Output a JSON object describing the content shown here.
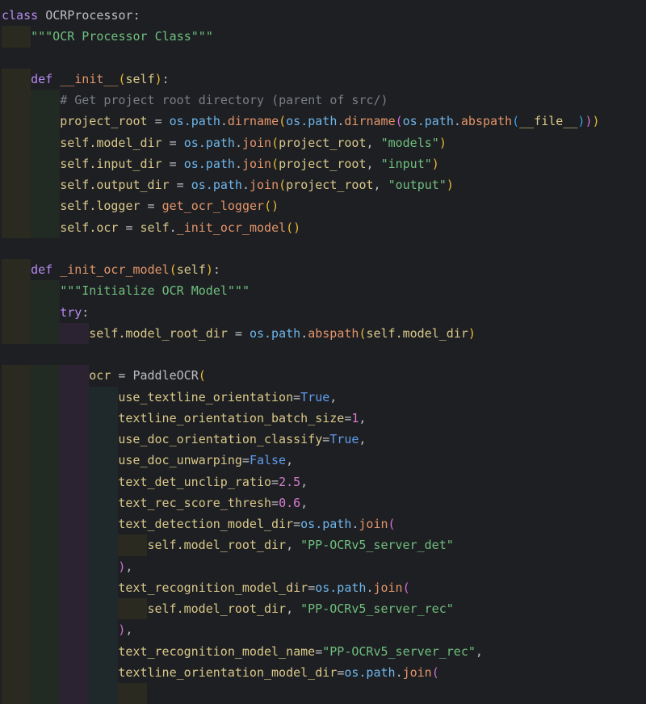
{
  "editor": {
    "lines": [
      {
        "indent": 0,
        "tokens": [
          [
            "class ",
            "k"
          ],
          [
            "OCRProcessor",
            "p"
          ],
          [
            ":",
            "p"
          ]
        ]
      },
      {
        "indent": 1,
        "tokens": [
          [
            "\"\"\"OCR Processor Class\"\"\"",
            "s"
          ]
        ]
      },
      {
        "indent": 0,
        "tokens": []
      },
      {
        "indent": 1,
        "tokens": [
          [
            "def ",
            "k"
          ],
          [
            "__init__",
            "f"
          ],
          [
            "(",
            "y"
          ],
          [
            "self",
            "v"
          ],
          [
            ")",
            "y"
          ],
          [
            ":",
            "p"
          ]
        ]
      },
      {
        "indent": 2,
        "tokens": [
          [
            "# Get project root directory (parent of src/)",
            "c"
          ]
        ]
      },
      {
        "indent": 2,
        "tokens": [
          [
            "project_root",
            "v"
          ],
          [
            " = ",
            "p"
          ],
          [
            "os.path",
            "o"
          ],
          [
            ".",
            "p"
          ],
          [
            "dirname",
            "f"
          ],
          [
            "(",
            "y"
          ],
          [
            "os.path",
            "o"
          ],
          [
            ".",
            "p"
          ],
          [
            "dirname",
            "f"
          ],
          [
            "(",
            "m"
          ],
          [
            "os.path",
            "o"
          ],
          [
            ".",
            "p"
          ],
          [
            "abspath",
            "f"
          ],
          [
            "(",
            "l"
          ],
          [
            "__file__",
            "v"
          ],
          [
            ")",
            "l"
          ],
          [
            ")",
            "m"
          ],
          [
            ")",
            "y"
          ]
        ]
      },
      {
        "indent": 2,
        "tokens": [
          [
            "self",
            "v"
          ],
          [
            ".model_dir",
            "v"
          ],
          [
            " = ",
            "p"
          ],
          [
            "os.path",
            "o"
          ],
          [
            ".",
            "p"
          ],
          [
            "join",
            "f"
          ],
          [
            "(",
            "y"
          ],
          [
            "project_root",
            "v"
          ],
          [
            ", ",
            "p"
          ],
          [
            "\"models\"",
            "s"
          ],
          [
            ")",
            "y"
          ]
        ]
      },
      {
        "indent": 2,
        "tokens": [
          [
            "self",
            "v"
          ],
          [
            ".input_dir",
            "v"
          ],
          [
            " = ",
            "p"
          ],
          [
            "os.path",
            "o"
          ],
          [
            ".",
            "p"
          ],
          [
            "join",
            "f"
          ],
          [
            "(",
            "y"
          ],
          [
            "project_root",
            "v"
          ],
          [
            ", ",
            "p"
          ],
          [
            "\"input\"",
            "s"
          ],
          [
            ")",
            "y"
          ]
        ]
      },
      {
        "indent": 2,
        "tokens": [
          [
            "self",
            "v"
          ],
          [
            ".output_dir",
            "v"
          ],
          [
            " = ",
            "p"
          ],
          [
            "os.path",
            "o"
          ],
          [
            ".",
            "p"
          ],
          [
            "join",
            "f"
          ],
          [
            "(",
            "y"
          ],
          [
            "project_root",
            "v"
          ],
          [
            ", ",
            "p"
          ],
          [
            "\"output\"",
            "s"
          ],
          [
            ")",
            "y"
          ]
        ]
      },
      {
        "indent": 2,
        "tokens": [
          [
            "self",
            "v"
          ],
          [
            ".logger",
            "v"
          ],
          [
            " = ",
            "p"
          ],
          [
            "get_ocr_logger",
            "f"
          ],
          [
            "()",
            "y"
          ]
        ]
      },
      {
        "indent": 2,
        "tokens": [
          [
            "self",
            "v"
          ],
          [
            ".ocr",
            "v"
          ],
          [
            " = ",
            "p"
          ],
          [
            "self",
            "v"
          ],
          [
            ".",
            "p"
          ],
          [
            "_init_ocr_model",
            "f"
          ],
          [
            "()",
            "y"
          ]
        ]
      },
      {
        "indent": 0,
        "tokens": []
      },
      {
        "indent": 1,
        "tokens": [
          [
            "def ",
            "k"
          ],
          [
            "_init_ocr_model",
            "f"
          ],
          [
            "(",
            "y"
          ],
          [
            "self",
            "v"
          ],
          [
            ")",
            "y"
          ],
          [
            ":",
            "p"
          ]
        ]
      },
      {
        "indent": 2,
        "tokens": [
          [
            "\"\"\"Initialize OCR Model\"\"\"",
            "s"
          ]
        ]
      },
      {
        "indent": 2,
        "tokens": [
          [
            "try",
            "k"
          ],
          [
            ":",
            "p"
          ]
        ]
      },
      {
        "indent": 3,
        "tokens": [
          [
            "self",
            "v"
          ],
          [
            ".model_root_dir",
            "v"
          ],
          [
            " = ",
            "p"
          ],
          [
            "os.path",
            "o"
          ],
          [
            ".",
            "p"
          ],
          [
            "abspath",
            "f"
          ],
          [
            "(",
            "y"
          ],
          [
            "self",
            "v"
          ],
          [
            ".model_dir",
            "v"
          ],
          [
            ")",
            "y"
          ]
        ]
      },
      {
        "indent": 0,
        "tokens": []
      },
      {
        "indent": 3,
        "tokens": [
          [
            "ocr",
            "v"
          ],
          [
            " = ",
            "p"
          ],
          [
            "PaddleOCR",
            "p"
          ],
          [
            "(",
            "y"
          ]
        ]
      },
      {
        "indent": 4,
        "tokens": [
          [
            "use_textline_orientation",
            "v"
          ],
          [
            "=",
            "p"
          ],
          [
            "True",
            "b"
          ],
          [
            ",",
            "p"
          ]
        ]
      },
      {
        "indent": 4,
        "tokens": [
          [
            "textline_orientation_batch_size",
            "v"
          ],
          [
            "=",
            "p"
          ],
          [
            "1",
            "n"
          ],
          [
            ",",
            "p"
          ]
        ]
      },
      {
        "indent": 4,
        "tokens": [
          [
            "use_doc_orientation_classify",
            "v"
          ],
          [
            "=",
            "p"
          ],
          [
            "True",
            "b"
          ],
          [
            ",",
            "p"
          ]
        ]
      },
      {
        "indent": 4,
        "tokens": [
          [
            "use_doc_unwarping",
            "v"
          ],
          [
            "=",
            "p"
          ],
          [
            "False",
            "b"
          ],
          [
            ",",
            "p"
          ]
        ]
      },
      {
        "indent": 4,
        "tokens": [
          [
            "text_det_unclip_ratio",
            "v"
          ],
          [
            "=",
            "p"
          ],
          [
            "2.5",
            "n"
          ],
          [
            ",",
            "p"
          ]
        ]
      },
      {
        "indent": 4,
        "tokens": [
          [
            "text_rec_score_thresh",
            "v"
          ],
          [
            "=",
            "p"
          ],
          [
            "0.6",
            "n"
          ],
          [
            ",",
            "p"
          ]
        ]
      },
      {
        "indent": 4,
        "tokens": [
          [
            "text_detection_model_dir",
            "v"
          ],
          [
            "=",
            "p"
          ],
          [
            "os.path",
            "o"
          ],
          [
            ".",
            "p"
          ],
          [
            "join",
            "f"
          ],
          [
            "(",
            "m"
          ]
        ]
      },
      {
        "indent": 5,
        "tokens": [
          [
            "self",
            "v"
          ],
          [
            ".model_root_dir",
            "v"
          ],
          [
            ", ",
            "p"
          ],
          [
            "\"PP-OCRv5_server_det\"",
            "s"
          ]
        ]
      },
      {
        "indent": 4,
        "tokens": [
          [
            ")",
            "m"
          ],
          [
            ",",
            "p"
          ]
        ]
      },
      {
        "indent": 4,
        "tokens": [
          [
            "text_recognition_model_dir",
            "v"
          ],
          [
            "=",
            "p"
          ],
          [
            "os.path",
            "o"
          ],
          [
            ".",
            "p"
          ],
          [
            "join",
            "f"
          ],
          [
            "(",
            "m"
          ]
        ]
      },
      {
        "indent": 5,
        "tokens": [
          [
            "self",
            "v"
          ],
          [
            ".model_root_dir",
            "v"
          ],
          [
            ", ",
            "p"
          ],
          [
            "\"PP-OCRv5_server_rec\"",
            "s"
          ]
        ]
      },
      {
        "indent": 4,
        "tokens": [
          [
            ")",
            "m"
          ],
          [
            ",",
            "p"
          ]
        ]
      },
      {
        "indent": 4,
        "tokens": [
          [
            "text_recognition_model_name",
            "v"
          ],
          [
            "=",
            "p"
          ],
          [
            "\"PP-OCRv5_server_rec\"",
            "s"
          ],
          [
            ",",
            "p"
          ]
        ]
      },
      {
        "indent": 4,
        "tokens": [
          [
            "textline_orientation_model_dir",
            "v"
          ],
          [
            "=",
            "p"
          ],
          [
            "os.path",
            "o"
          ],
          [
            ".",
            "p"
          ],
          [
            "join",
            "f"
          ],
          [
            "(",
            "m"
          ]
        ]
      },
      {
        "indent": 5,
        "tokens": []
      }
    ]
  }
}
